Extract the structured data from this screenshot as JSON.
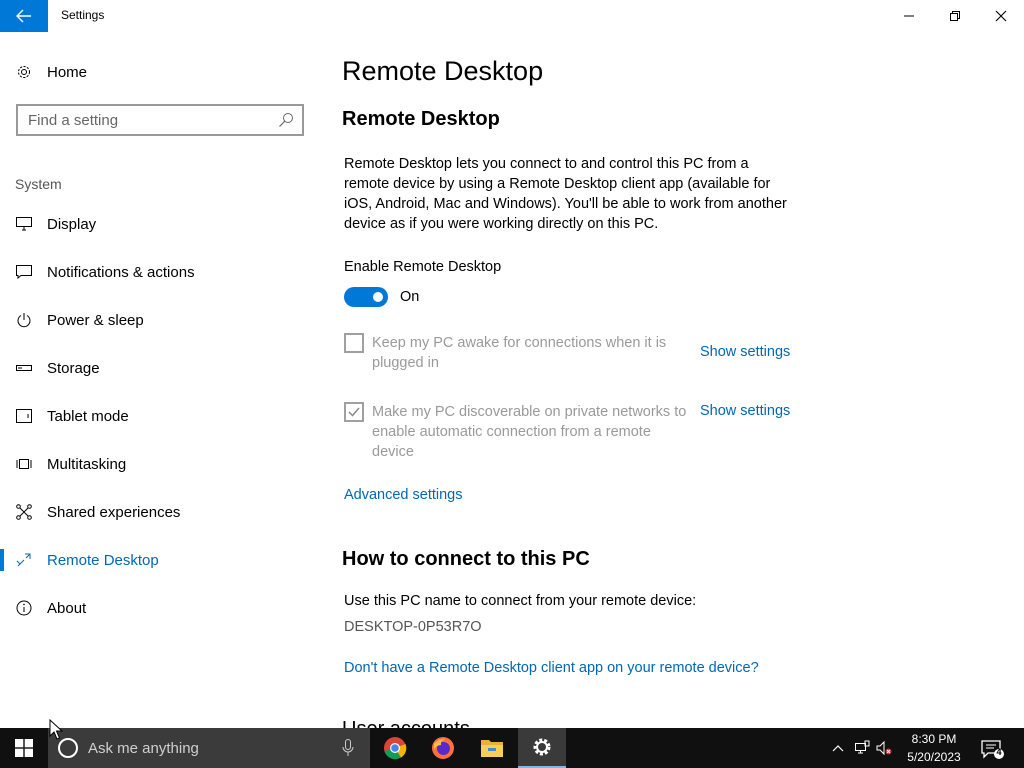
{
  "window": {
    "title": "Settings",
    "back_icon": "arrow-left-icon",
    "controls": [
      "minimize-icon",
      "restore-icon",
      "close-icon"
    ]
  },
  "sidebar": {
    "home_label": "Home",
    "search_placeholder": "Find a setting",
    "section_label": "System",
    "items": [
      {
        "label": "Display",
        "icon": "monitor-icon"
      },
      {
        "label": "Notifications & actions",
        "icon": "message-icon"
      },
      {
        "label": "Power & sleep",
        "icon": "power-icon"
      },
      {
        "label": "Storage",
        "icon": "storage-icon"
      },
      {
        "label": "Tablet mode",
        "icon": "tablet-icon"
      },
      {
        "label": "Multitasking",
        "icon": "multitask-icon"
      },
      {
        "label": "Shared experiences",
        "icon": "shared-icon"
      },
      {
        "label": "Remote Desktop",
        "icon": "remote-desktop-icon",
        "selected": true
      },
      {
        "label": "About",
        "icon": "info-icon"
      }
    ]
  },
  "main": {
    "page_title": "Remote Desktop",
    "section_title": "Remote Desktop",
    "description": "Remote Desktop lets you connect to and control this PC from a remote device by using a Remote Desktop client app (available for iOS, Android, Mac and Windows). You'll be able to work from another device as if you were working directly on this PC.",
    "toggle_label": "Enable Remote Desktop",
    "toggle_state": "On",
    "keep_awake_label": "Keep my PC awake for connections when it is plugged in",
    "keep_awake_checked": false,
    "discoverable_label": "Make my PC discoverable on private networks to enable automatic connection from a remote device",
    "discoverable_checked": true,
    "show_settings": "Show settings",
    "advanced_settings": "Advanced settings",
    "how_to_title": "How to connect to this PC",
    "pc_name_intro": "Use this PC name to connect from your remote device:",
    "pc_name": "DESKTOP-0P53R7O",
    "client_app_link": "Don't have a Remote Desktop client app on your remote device?",
    "cut_heading": "User accounts"
  },
  "taskbar": {
    "search_placeholder": "Ask me anything",
    "apps": [
      "chrome-icon",
      "firefox-icon",
      "file-explorer-icon",
      "settings-gear-icon"
    ],
    "time": "8:30 PM",
    "date": "5/20/2023",
    "notification_count": "4"
  },
  "colors": {
    "accent": "#0078d7",
    "link": "#0067b8",
    "taskbar": "#101010"
  }
}
